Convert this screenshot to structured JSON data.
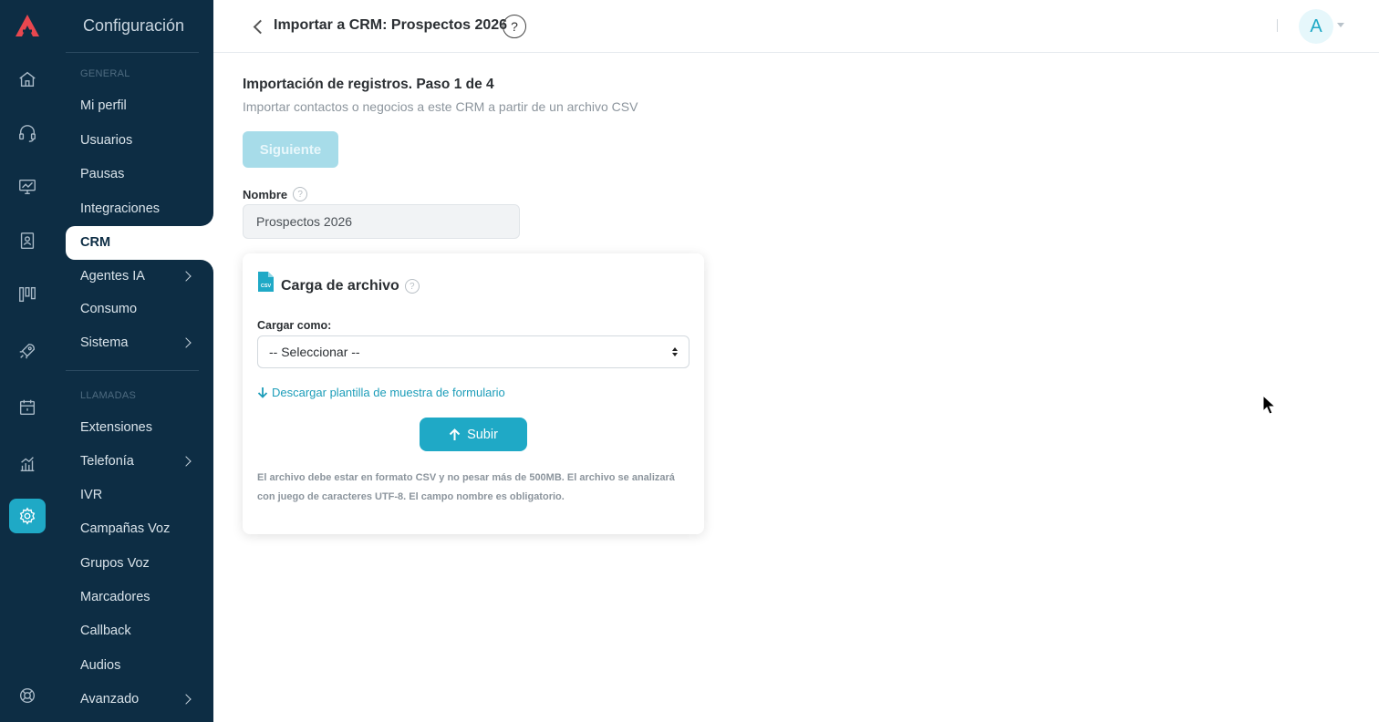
{
  "sidebar": {
    "title": "Configuración",
    "section_general": "GENERAL",
    "section_calls": "LLAMADAS",
    "items_general": [
      {
        "label": "Mi perfil"
      },
      {
        "label": "Usuarios"
      },
      {
        "label": "Pausas"
      },
      {
        "label": "Integraciones"
      },
      {
        "label": "CRM"
      },
      {
        "label": "Agentes IA"
      },
      {
        "label": "Consumo"
      },
      {
        "label": "Sistema"
      }
    ],
    "items_calls": [
      {
        "label": "Extensiones"
      },
      {
        "label": "Telefonía"
      },
      {
        "label": "IVR"
      },
      {
        "label": "Campañas Voz"
      },
      {
        "label": "Grupos Voz"
      },
      {
        "label": "Marcadores"
      },
      {
        "label": "Callback"
      },
      {
        "label": "Audios"
      },
      {
        "label": "Avanzado"
      }
    ]
  },
  "rail": {
    "icons": [
      "home-icon",
      "headset-icon",
      "monitor-icon",
      "contacts-book-icon",
      "kanban-icon",
      "rocket-icon",
      "calendar-icon",
      "analytics-icon",
      "settings-icon",
      "help-lifebuoy-icon"
    ],
    "active": "settings-icon",
    "accent": "#1fa9c6",
    "logo_color": "#e8474f"
  },
  "header": {
    "title": "Importar a CRM: Prospectos 2026",
    "help": "?",
    "avatar_initial": "A"
  },
  "main": {
    "step_title": "Importación de registros. Paso 1 de 4",
    "step_subtitle": "Importar contactos o negocios a este CRM a partir de un archivo CSV",
    "next_label": "Siguiente",
    "name_label": "Nombre",
    "name_value": "Prospectos 2026",
    "help_mark": "?",
    "card": {
      "title": "Carga de archivo",
      "file_badge": "CSV",
      "load_as_label": "Cargar como:",
      "select_value": "-- Seleccionar --",
      "download_link": "Descargar plantilla de muestra de formulario",
      "upload_label": "Subir",
      "note": "El archivo debe estar en formato CSV y no pesar más de 500MB. El archivo se analizará con juego de caracteres UTF-8. El campo nombre es obligatorio."
    }
  },
  "colors": {
    "sidebar_bg": "#0d2d44",
    "accent": "#1fa9c6",
    "disabled_button": "#a7dce9"
  }
}
